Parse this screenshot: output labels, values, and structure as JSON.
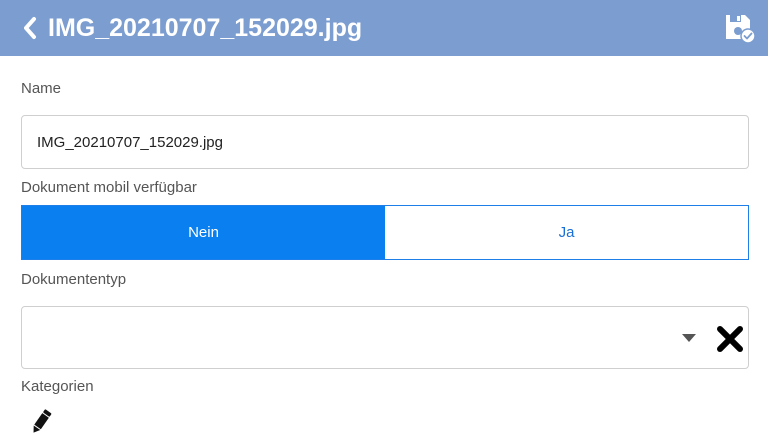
{
  "header": {
    "title": "IMG_20210707_152029.jpg",
    "back_icon": "chevron-left-icon",
    "save_icon": "save-icon",
    "background": "#7b9dd0"
  },
  "form": {
    "name": {
      "label": "Name",
      "value": "IMG_20210707_152029.jpg"
    },
    "mobile_available": {
      "label": "Dokument mobil verfügbar",
      "options": [
        "Nein",
        "Ja"
      ],
      "selected": "Nein",
      "accent": "#0a7ff0"
    },
    "document_type": {
      "label": "Dokumententyp",
      "value": "",
      "dropdown_icon": "caret-down-icon",
      "clear_icon": "close-icon"
    },
    "categories": {
      "label": "Kategorien",
      "edit_icon": "pencil-icon"
    }
  }
}
